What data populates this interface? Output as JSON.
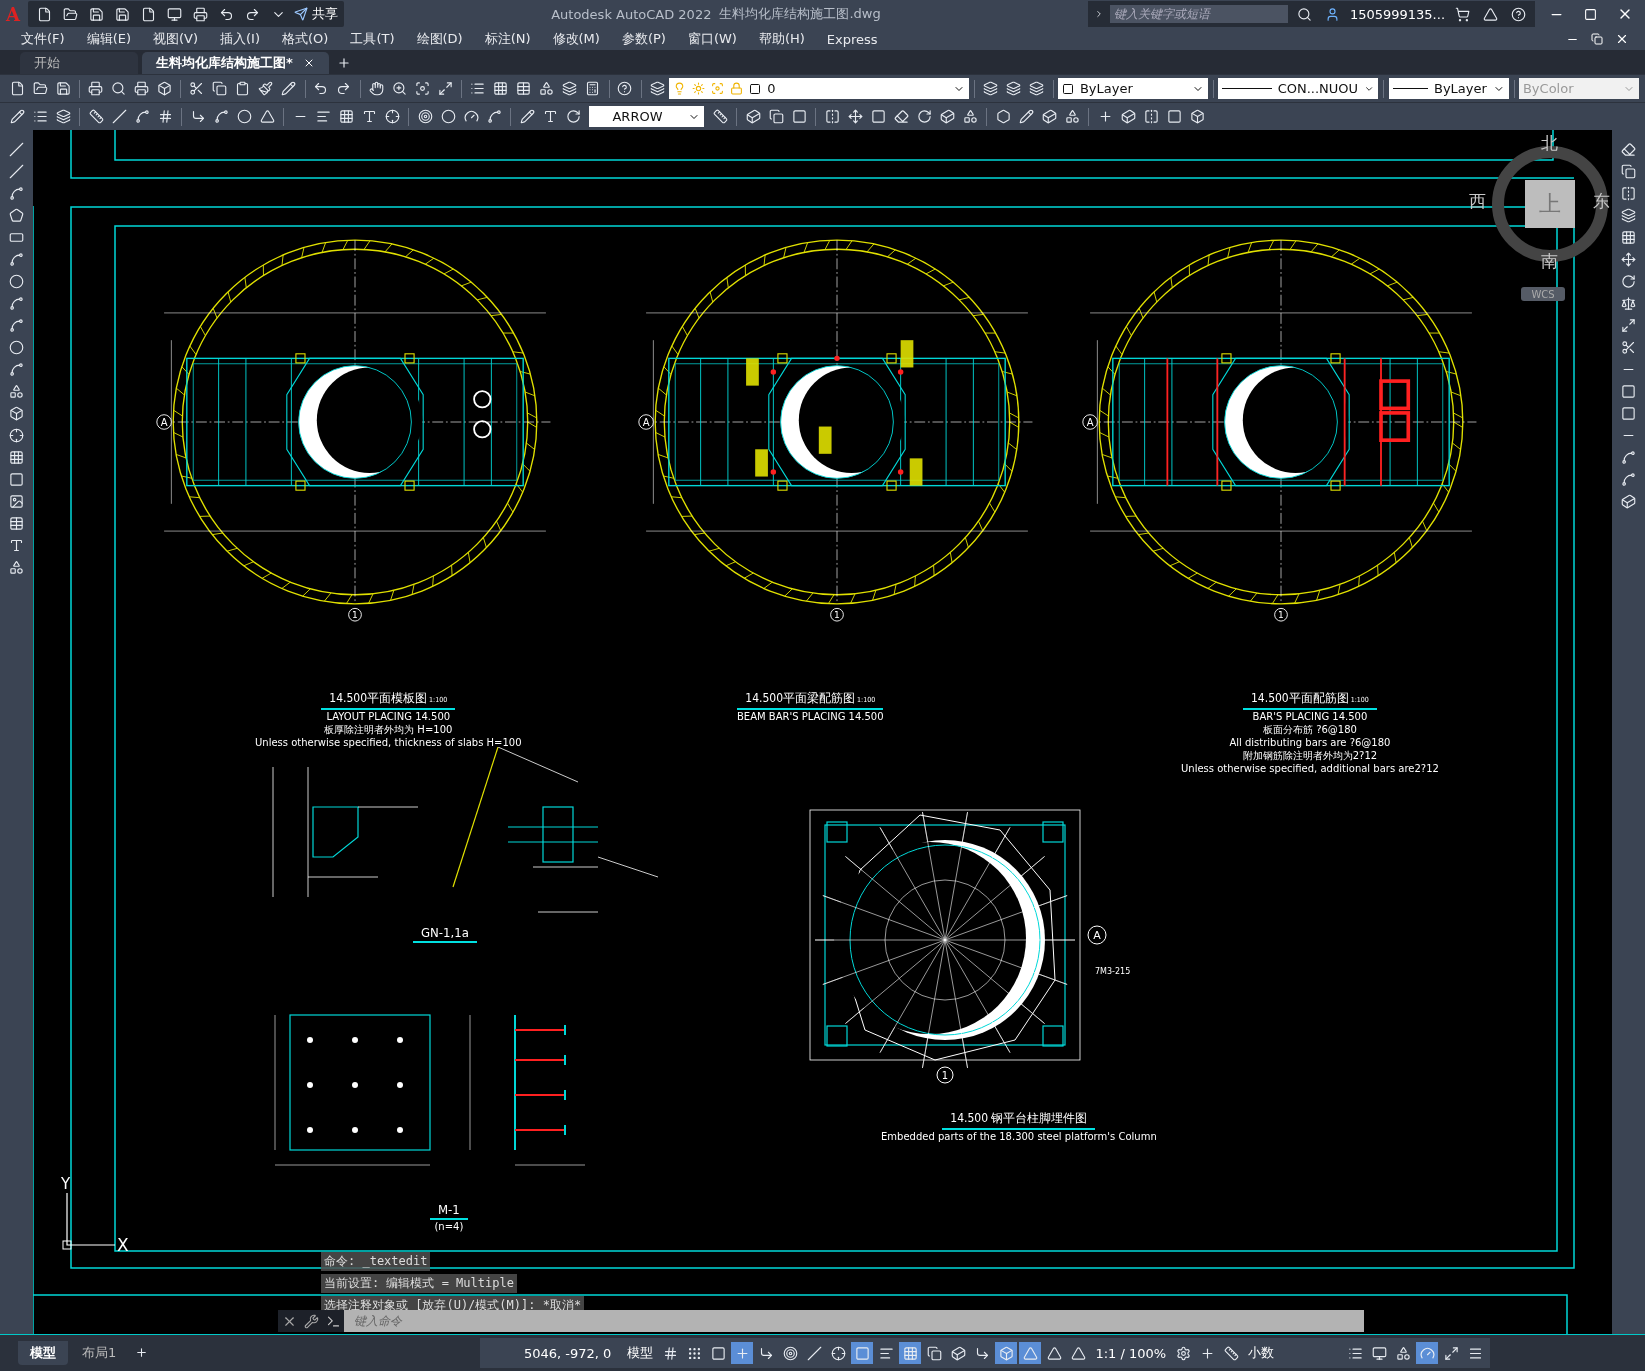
{
  "title_bar": {
    "logo": "A",
    "share": "共享",
    "app_title": "Autodesk AutoCAD 2022",
    "file_name": "生料均化库结构施工图.dwg",
    "search": {
      "placeholder": "键入关键字或短语"
    },
    "user": "1505999135..."
  },
  "menu": [
    "文件(F)",
    "编辑(E)",
    "视图(V)",
    "插入(I)",
    "格式(O)",
    "工具(T)",
    "绘图(D)",
    "标注(N)",
    "修改(M)",
    "参数(P)",
    "窗口(W)",
    "帮助(H)",
    "Express"
  ],
  "doc_tabs": [
    {
      "label": "开始",
      "selected": false
    },
    {
      "label": "生料均化库结构施工图*",
      "selected": true
    }
  ],
  "toolbar": {
    "layer": "0",
    "text_style": "ARROW",
    "color_setting": "ByLayer",
    "linetype": "CON...NUOU",
    "lineweight": "ByLayer",
    "plot_style": "ByColor"
  },
  "viewcube": {
    "north": "北",
    "west": "西",
    "east": "东",
    "south": "南",
    "top": "上",
    "wcs": "WCS"
  },
  "plans": [
    {
      "kind": "formwork",
      "axis_row": "A",
      "axis_col": "1",
      "title": "14.500平面模板图",
      "scale": "1:100",
      "notes": [
        "LAYOUT  PLACING 14.500",
        "板厚除注明者外均为 H=100",
        "Unless otherwise specified, thickness of slabs H=100"
      ]
    },
    {
      "kind": "beam",
      "axis_row": "A",
      "axis_col": "1",
      "title": "14.500平面梁配筋图",
      "scale": "1:100",
      "notes": [
        "BEAM BAR'S PLACING 14.500"
      ]
    },
    {
      "kind": "slab",
      "axis_row": "A",
      "axis_col": "1",
      "title": "14.500平面配筋图",
      "scale": "1:100",
      "notes": [
        "BAR'S PLACING 14.500",
        "板面分布筋 ?6@180",
        "All distributing bars are ?6@180",
        "附加钢筋除注明者外均为2?12",
        "Unless otherwise specified, additional bars are2?12"
      ]
    }
  ],
  "details": [
    {
      "title": "GN-1,1a"
    },
    {
      "title": "M-1",
      "subtitle": "(n=4)"
    }
  ],
  "embedded": {
    "title": "14.500 钢平台柱脚埋件图",
    "note": "Embedded parts of the 18.300 steel platform's Column",
    "axis_row": "A",
    "axis_col": "1",
    "tag": "7M3-215"
  },
  "ucs": {
    "x": "X",
    "y": "Y"
  },
  "command_history": [
    "命令: _textedit",
    "当前设置: 编辑模式 = Multiple",
    "选择注释对象或 [放弃(U)/模式(M)]: *取消*"
  ],
  "command_input": {
    "placeholder": "键入命令"
  },
  "layout_tabs": [
    {
      "label": "模型",
      "selected": true
    },
    {
      "label": "布局1",
      "selected": false
    }
  ],
  "status": {
    "coords": "5046, -972, 0",
    "space": "模型",
    "scale": "1:1 / 100%",
    "units": "小数"
  },
  "status_toggles": [
    {
      "kind": "grid",
      "on": false
    },
    {
      "kind": "snap",
      "on": false
    },
    {
      "kind": "constraints",
      "on": false
    },
    {
      "kind": "dynamic_input",
      "on": true
    },
    {
      "kind": "ortho",
      "on": false
    },
    {
      "kind": "polar",
      "on": false
    },
    {
      "kind": "isodraft",
      "on": false
    },
    {
      "kind": "object_snap",
      "on": false
    },
    {
      "kind": "selection",
      "on": true
    },
    {
      "kind": "lineweight",
      "on": false
    },
    {
      "kind": "transparency",
      "on": true
    },
    {
      "kind": "cycling",
      "on": false
    },
    {
      "kind": "osnap_3d",
      "on": false
    },
    {
      "kind": "tracking",
      "on": false
    },
    {
      "kind": "gizmo",
      "on": true
    },
    {
      "kind": "annotation",
      "on": true
    },
    {
      "kind": "autoscale",
      "on": false
    },
    {
      "kind": "annoscale",
      "on": false
    }
  ],
  "status_toggles_right": [
    {
      "kind": "quick_properties",
      "on": false
    },
    {
      "kind": "lock_ui",
      "on": false
    },
    {
      "kind": "isolate",
      "on": false
    },
    {
      "kind": "hardware",
      "on": true
    },
    {
      "kind": "fullscreen",
      "on": false
    }
  ]
}
